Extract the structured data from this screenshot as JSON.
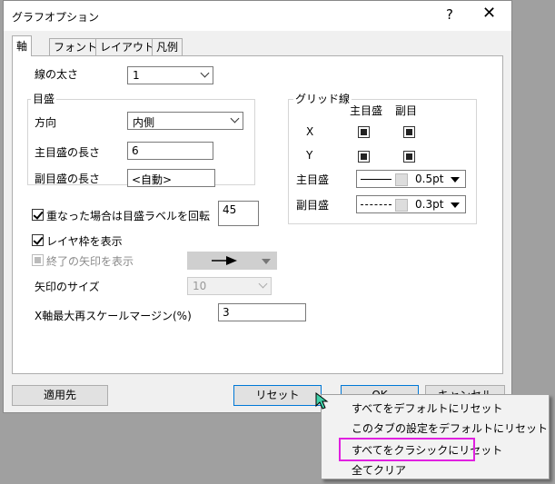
{
  "window": {
    "title": "グラフオプション",
    "help": "?",
    "close": "✕"
  },
  "tabs": [
    "軸",
    "フォント",
    "レイアウト",
    "凡例"
  ],
  "axis": {
    "line_width_label": "線の太さ",
    "line_width_value": "1",
    "ticks_group_label": "目盛",
    "direction_label": "方向",
    "direction_value": "内側",
    "major_len_label": "主目盛の長さ",
    "major_len_value": "6",
    "minor_len_label": "副目盛の長さ",
    "minor_len_value": "<自動>",
    "rotate_label": "重なった場合は目盛ラベルを回転",
    "rotate_value": "45",
    "layer_frame_label": "レイヤ枠を表示",
    "arrow_end_label": "終了の矢印を表示",
    "arrow_size_label": "矢印のサイズ",
    "arrow_size_value": "10",
    "x_margin_label": "X軸最大再スケールマージン(%)",
    "x_margin_value": "3"
  },
  "grid": {
    "title": "グリッド線",
    "col_major": "主目盛",
    "col_minor": "副目",
    "row_x": "X",
    "row_y": "Y",
    "major_label": "主目盛",
    "major_value": "0.5pt",
    "minor_label": "副目盛",
    "minor_value": "0.3pt"
  },
  "buttons": {
    "apply": "適用先",
    "reset": "リセット",
    "ok": "OK",
    "cancel": "キャンセル"
  },
  "menu": {
    "items": [
      "すべてをデフォルトにリセット",
      "このタブの設定をデフォルトにリセット",
      "すべてをクラシックにリセット",
      "全てクリア"
    ]
  },
  "colors": {
    "highlight": "#e020e0",
    "focus": "#0078d7"
  }
}
